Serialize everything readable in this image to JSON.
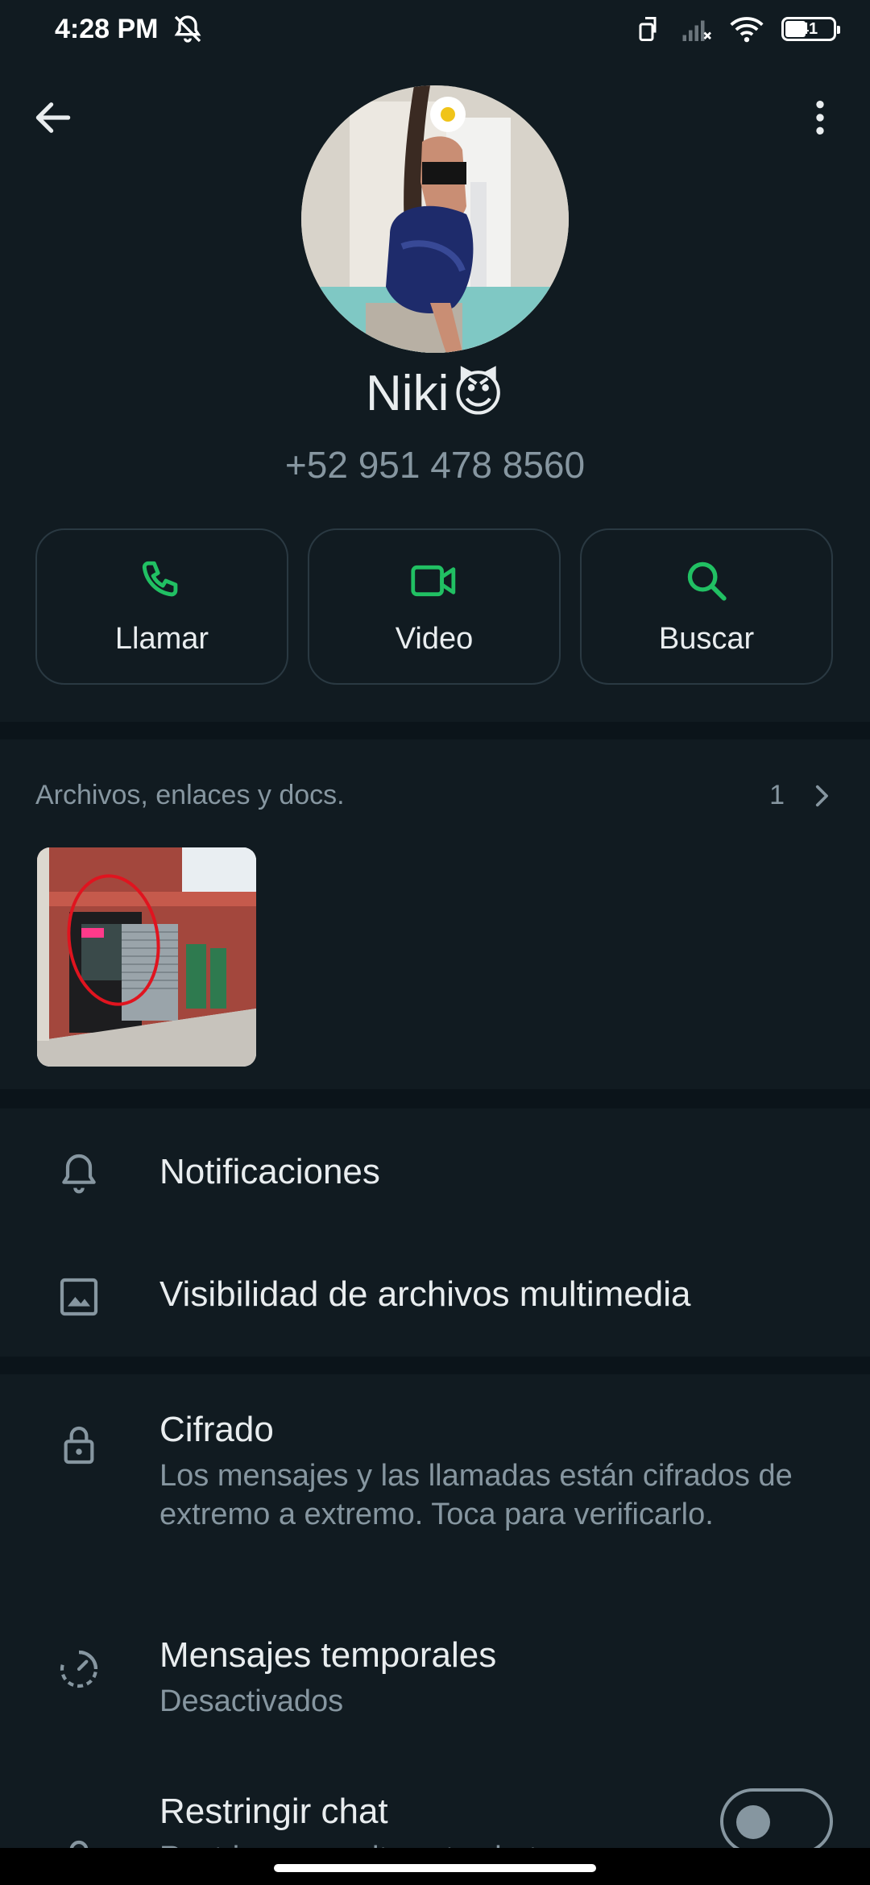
{
  "status_bar": {
    "time": "4:28 PM",
    "battery": "41",
    "icons": [
      "mute-alarm-icon",
      "screen-rotate-icon",
      "signal-icon",
      "wifi-icon",
      "battery-icon"
    ]
  },
  "header": {
    "back_icon": "arrow-left-icon",
    "more_icon": "more-vertical-icon",
    "contact_name": "Niki",
    "contact_emoji": "😈",
    "phone": "+52 951 478 8560"
  },
  "actions": [
    {
      "label": "Llamar",
      "icon": "phone-icon"
    },
    {
      "label": "Video",
      "icon": "video-icon"
    },
    {
      "label": "Buscar",
      "icon": "search-icon"
    }
  ],
  "files": {
    "title": "Archivos, enlaces y docs.",
    "count": "1"
  },
  "settings": {
    "notifications": "Notificaciones",
    "media_visibility": "Visibilidad de archivos multimedia",
    "encryption_title": "Cifrado",
    "encryption_sub": "Los mensajes y las llamadas están cifrados de extremo a extremo. Toca para verificarlo.",
    "disappearing_title": "Mensajes temporales",
    "disappearing_sub": "Desactivados",
    "restrict_title": "Restringir chat",
    "restrict_sub": "Restringe y oculta este chat"
  },
  "colors": {
    "accent_green": "#21c063",
    "background": "#111b21",
    "secondary_text": "#8696a0"
  }
}
